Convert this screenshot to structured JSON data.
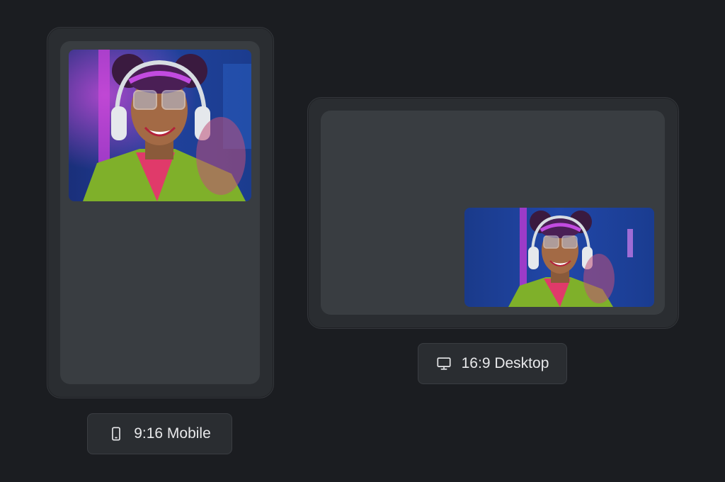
{
  "mobile": {
    "label": "9:16 Mobile",
    "icon": "smartphone-icon"
  },
  "desktop": {
    "label": "16:9 Desktop",
    "icon": "monitor-icon"
  },
  "colors": {
    "background": "#1b1d21",
    "frame": "#2a2d31",
    "screen": "#393d41",
    "text": "#e8e9eb"
  }
}
